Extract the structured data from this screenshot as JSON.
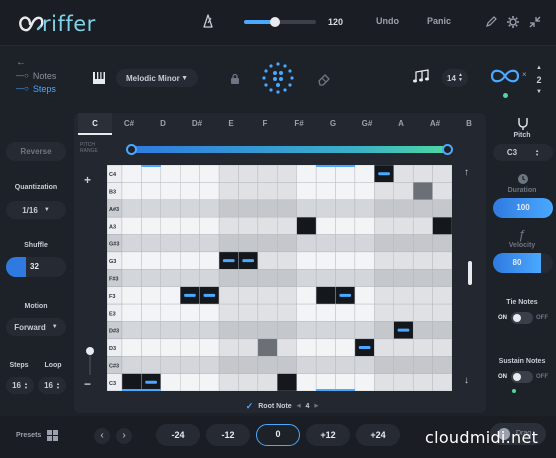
{
  "app": {
    "logo_text": "riffer"
  },
  "topbar": {
    "tempo": "120",
    "undo": "Undo",
    "panic": "Panic"
  },
  "modes": {
    "notes": "Notes",
    "steps": "Steps"
  },
  "scale": {
    "selected": "Melodic Minor"
  },
  "notes_per": {
    "value": "14"
  },
  "loops": {
    "value": "2"
  },
  "keys": [
    "C",
    "C#",
    "D",
    "D#",
    "E",
    "F",
    "F#",
    "G",
    "G#",
    "A",
    "A#",
    "B"
  ],
  "active_key": "C",
  "pitch_range_label": "PITCH RANGE",
  "row_labels": [
    "C4",
    "B3",
    "A#3",
    "A3",
    "G#3",
    "G3",
    "F#3",
    "F3",
    "E3",
    "D#3",
    "D3",
    "C#3",
    "C3"
  ],
  "left": {
    "reverse": "Reverse",
    "quantization_label": "Quantization",
    "quantization_value": "1/16",
    "shuffle_label": "Shuffle",
    "shuffle_value": "32",
    "motion_label": "Motion",
    "motion_value": "Forward",
    "steps_label": "Steps",
    "loop_label": "Loop",
    "steps_value": "16",
    "loop_value": "16"
  },
  "right": {
    "pitch_label": "Pitch",
    "pitch_value": "C3",
    "duration_label": "Duration",
    "duration_value": "100",
    "velocity_label": "Velocity",
    "velocity_value": "80",
    "tie_label": "Tie Notes",
    "tie_on": "ON",
    "tie_off": "OFF",
    "sustain_label": "Sustain Notes",
    "sustain_on": "ON",
    "sustain_off": "OFF"
  },
  "root_note": {
    "label": "Root Note",
    "value": "4"
  },
  "bottom": {
    "presets": "Presets",
    "oct_buttons": [
      "-24",
      "-12",
      "0",
      "+12",
      "+24"
    ],
    "active_oct": "0",
    "drag": "Drag"
  },
  "watermark": "cloudmidi.net",
  "grid_notes": [
    {
      "row": 0,
      "col": 13
    },
    {
      "row": 5,
      "col": 5
    },
    {
      "row": 7,
      "col": 4
    },
    {
      "row": 7,
      "col": 11
    },
    {
      "row": 9,
      "col": 14
    },
    {
      "row": 10,
      "col": 12
    },
    {
      "row": 12,
      "col": 1
    }
  ],
  "grid_gray_notes": [
    {
      "row": 1,
      "col": 15
    },
    {
      "row": 10,
      "col": 7
    }
  ],
  "grid_black_cells": [
    {
      "row": 0,
      "col": 13
    },
    {
      "row": 3,
      "col": 9
    },
    {
      "row": 3,
      "col": 16
    },
    {
      "row": 5,
      "col": 5
    },
    {
      "row": 5,
      "col": 6
    },
    {
      "row": 7,
      "col": 3
    },
    {
      "row": 7,
      "col": 4
    },
    {
      "row": 7,
      "col": 10
    },
    {
      "row": 7,
      "col": 11
    },
    {
      "row": 9,
      "col": 14
    },
    {
      "row": 10,
      "col": 12
    },
    {
      "row": 12,
      "col": 0
    },
    {
      "row": 12,
      "col": 1
    },
    {
      "row": 12,
      "col": 8
    }
  ],
  "colors": {
    "accent": "#4aa8ff",
    "bg": "#1d2128",
    "panel": "#262a32"
  }
}
